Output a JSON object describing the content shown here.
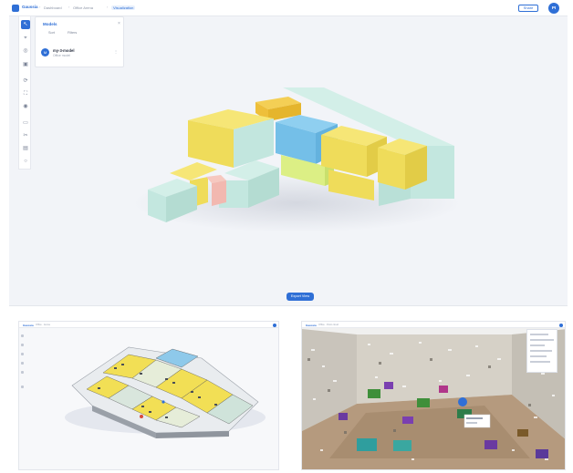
{
  "app": {
    "brand": "Gaussia",
    "breadcrumbs": [
      "Dashboard",
      "Office Arena",
      "Visualization"
    ],
    "share_label": "Share",
    "avatar_initials": "PI"
  },
  "toolbar": {
    "tools": [
      "cursor-icon",
      "measure-icon",
      "layers-icon",
      "box-icon",
      "orbit-icon",
      "fullscreen-icon",
      "pin-icon",
      "clip-icon",
      "cut-icon",
      "camera-icon",
      "settings-icon"
    ]
  },
  "models_panel": {
    "title": "Models",
    "close_symbol": "×",
    "tabs": [
      "Sort",
      "Filters"
    ],
    "model": {
      "icon_initial": "M",
      "name": "my-3-model",
      "subtitle": "Office model",
      "menu_symbol": "⋮"
    }
  },
  "primary_action": {
    "label": "Export View"
  },
  "colors": {
    "accent": "#2f6fd6",
    "room_yellow": "#f3e36a",
    "room_mint": "#bfe4dc",
    "room_blue": "#7ec4ec",
    "room_lime": "#dcef85",
    "room_orange": "#f0c23a",
    "room_pink": "#f2b8b0"
  },
  "sub_left": {
    "brand": "Gaussia",
    "crumb": "Office · Arena"
  },
  "sub_right": {
    "brand": "Gaussia",
    "crumb": "Office · Point cloud"
  }
}
